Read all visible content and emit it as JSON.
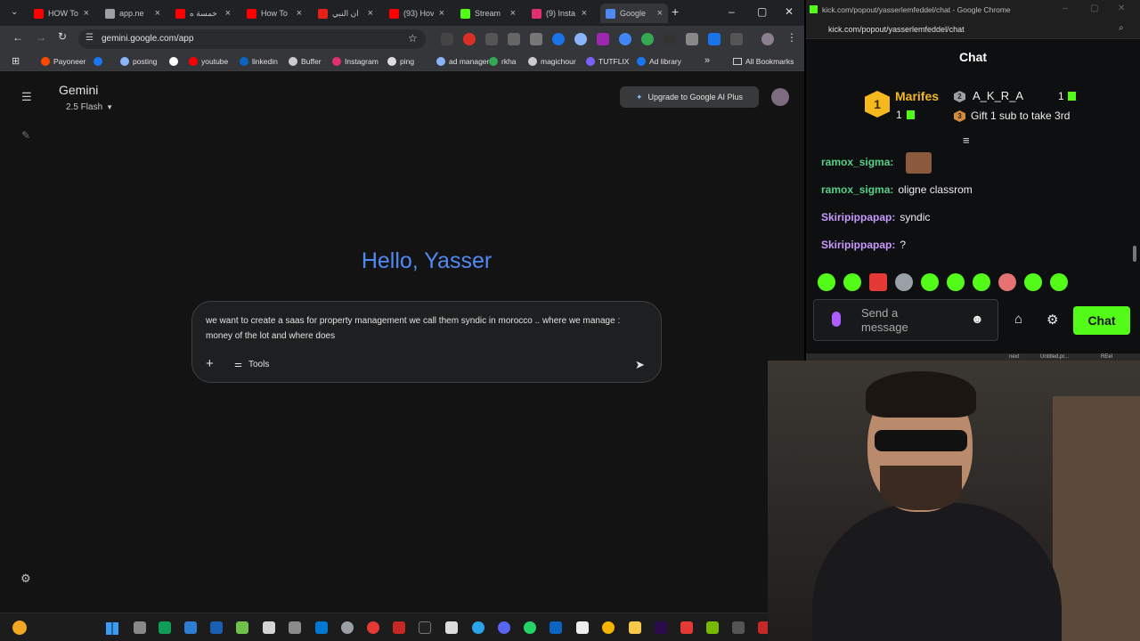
{
  "browser": {
    "tabs": [
      {
        "label": "HOW To",
        "color": "#ff0000"
      },
      {
        "label": "app.ne",
        "color": "#9aa0a6"
      },
      {
        "label": "خمسة ه",
        "color": "#ff0000"
      },
      {
        "label": "How To",
        "color": "#ff0000"
      },
      {
        "label": "ان النبي",
        "color": "#e62117"
      },
      {
        "label": "(93) Hov",
        "color": "#ff0000"
      },
      {
        "label": "Stream",
        "color": "#53fc18"
      },
      {
        "label": "(9) Insta",
        "color": "#e1306c"
      },
      {
        "label": "Google",
        "color": "#4f8af2"
      }
    ],
    "url": "gemini.google.com/app",
    "bookmarks": [
      {
        "label": "Payoneer",
        "color": "#ff4800"
      },
      {
        "label": "",
        "color": "#1877f2"
      },
      {
        "label": "posting",
        "color": "#8ab4f8"
      },
      {
        "label": "",
        "color": "#ffffff"
      },
      {
        "label": "youtube",
        "color": "#ff0000"
      },
      {
        "label": "linkedin",
        "color": "#0a66c2"
      },
      {
        "label": "Buffer",
        "color": "#cccccc"
      },
      {
        "label": "Instagram",
        "color": "#e1306c"
      },
      {
        "label": "ping",
        "color": "#dddddd"
      },
      {
        "label": "ad manager",
        "color": "#8ab4f8"
      },
      {
        "label": "rkha",
        "color": "#34a853"
      },
      {
        "label": "magichour",
        "color": "#cccccc"
      },
      {
        "label": "TUTFLIX",
        "color": "#7b61ff"
      },
      {
        "label": "Ad library",
        "color": "#1877f2"
      }
    ],
    "all_bookmarks": "All Bookmarks"
  },
  "gemini": {
    "title": "Gemini",
    "model": "2.5 Flash",
    "upgrade": "Upgrade to Google AI Plus",
    "greeting": "Hello, Yasser",
    "prompt": "we want to create a saas for property management we call them syndic  in morocco .. where we manage : money of the lot and where does",
    "tools": "Tools"
  },
  "chat": {
    "window_title": "kick.com/popout/yasserlemfeddel/chat - Google Chrome",
    "address": "kick.com/popout/yasserlemfeddel/chat",
    "header": "Chat",
    "leaderboard": {
      "first_name": "Marifes",
      "first_rank": "1",
      "first_count": "1",
      "second_name": "A_K_R_A",
      "second_rank": "2",
      "second_count": "1",
      "third_rank": "3",
      "third_text": "Gift 1 sub to take 3rd"
    },
    "messages": [
      {
        "user": "ramox_sigma:",
        "text": "",
        "color": "#56d18a"
      },
      {
        "user": "ramox_sigma:",
        "text": "oligne classrom",
        "color": "#56d18a"
      },
      {
        "user": "Skiripippapap:",
        "text": "syndic",
        "color": "#c79bff"
      },
      {
        "user": "Skiripippapap:",
        "text": "?",
        "color": "#c79bff"
      }
    ],
    "input_placeholder": "Send a message",
    "send_label": "Chat",
    "accent": "#53fc18"
  },
  "overlay_labels": [
    "next",
    "Untitled.pr...",
    "REel"
  ]
}
